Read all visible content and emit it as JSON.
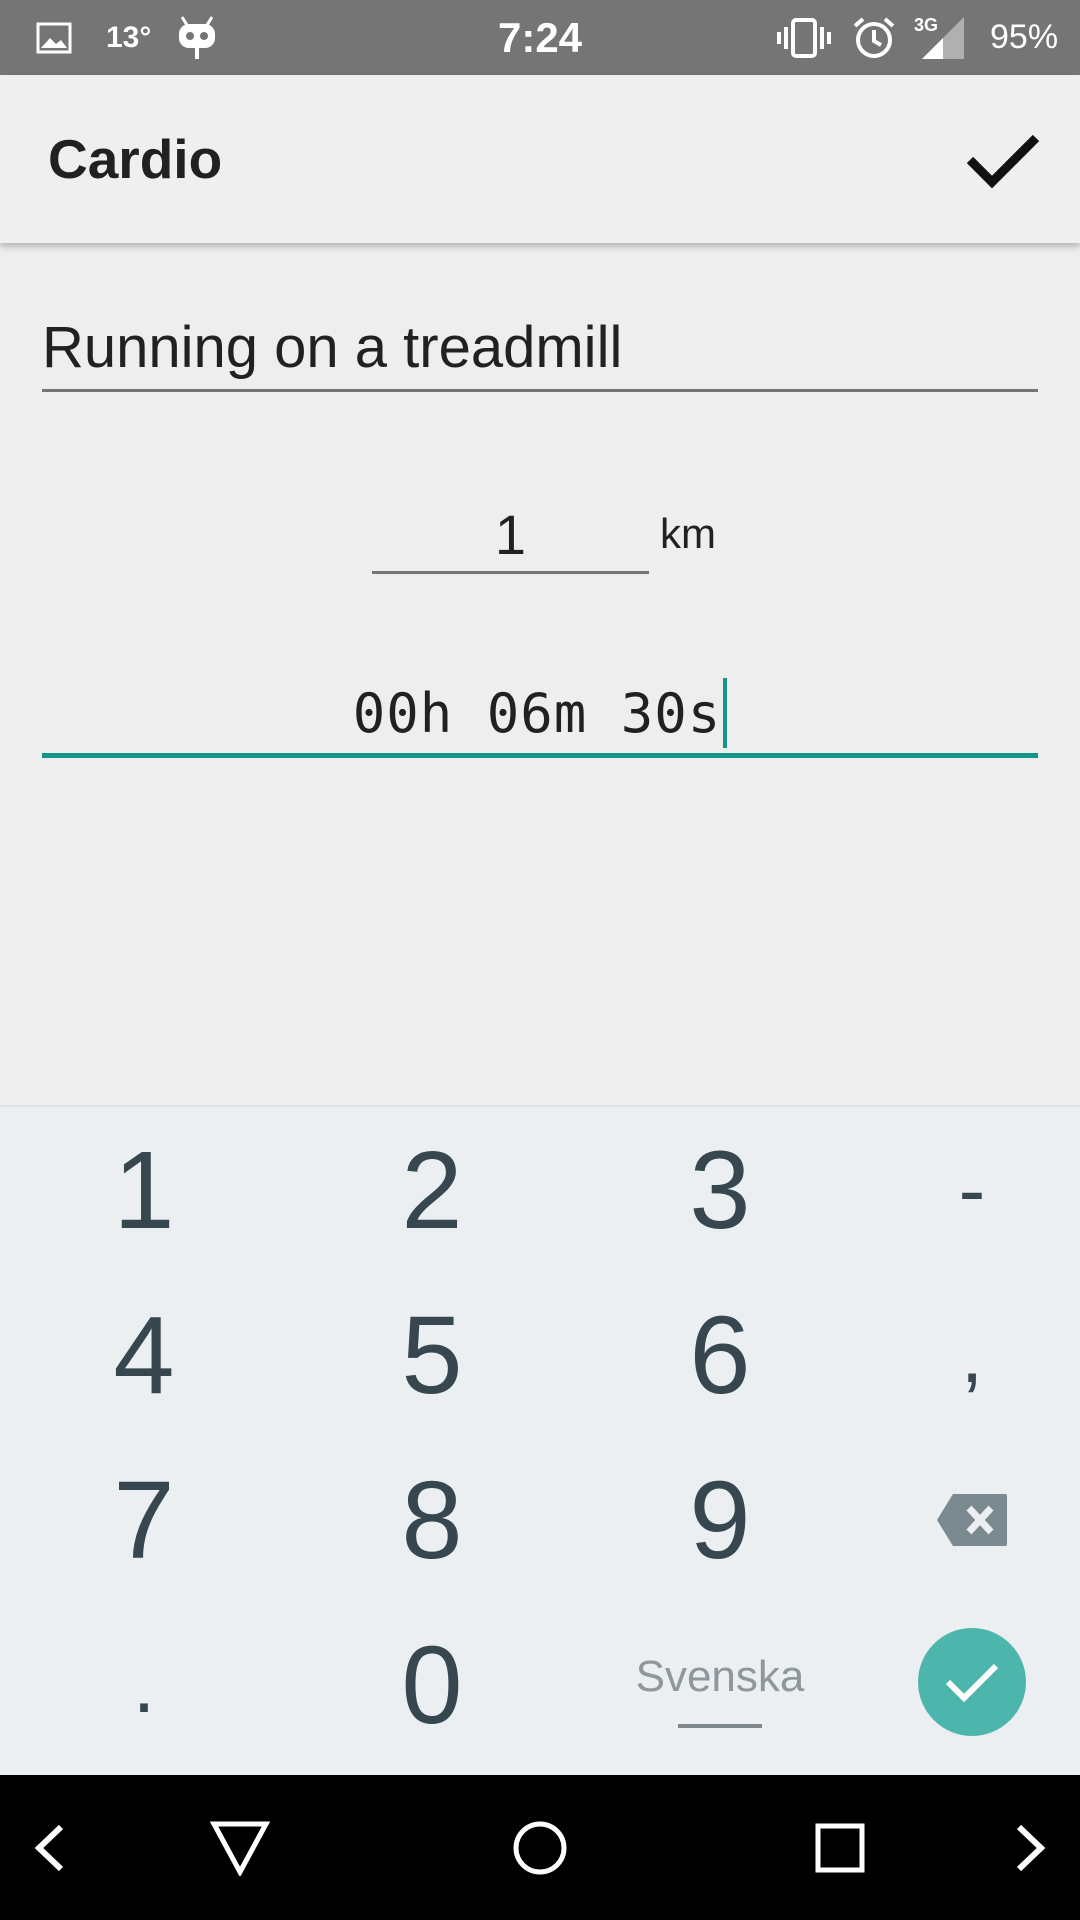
{
  "status_bar": {
    "temperature": "13°",
    "time": "7:24",
    "network": "3G",
    "battery": "95%",
    "icons": [
      "gallery-icon",
      "android-icon",
      "vibrate-icon",
      "alarm-icon",
      "signal-icon"
    ]
  },
  "app_bar": {
    "title": "Cardio",
    "confirm_icon": "check-icon"
  },
  "form": {
    "activity_name": "Running on a treadmill",
    "distance_value": "1",
    "distance_unit": "km",
    "duration_value": "00h 06m 30s"
  },
  "keypad": {
    "digits": [
      "1",
      "2",
      "3",
      "4",
      "5",
      "6",
      "7",
      "8",
      "9",
      "0"
    ],
    "minus": "-",
    "comma": ",",
    "dot": ".",
    "language": "Svenska",
    "backspace_icon": "backspace-icon",
    "enter_icon": "check-circle-icon"
  },
  "nav_bar": {
    "icons": [
      "left-arrow-icon",
      "back-triangle-icon",
      "home-circle-icon",
      "recents-square-icon",
      "right-arrow-icon"
    ]
  },
  "colors": {
    "status_bar": "#757575",
    "app_bar": "#efefef",
    "accent": "#139688",
    "keypad_bg": "#eceff1",
    "key_text": "#37474f",
    "enter_button": "#4db6ac"
  }
}
